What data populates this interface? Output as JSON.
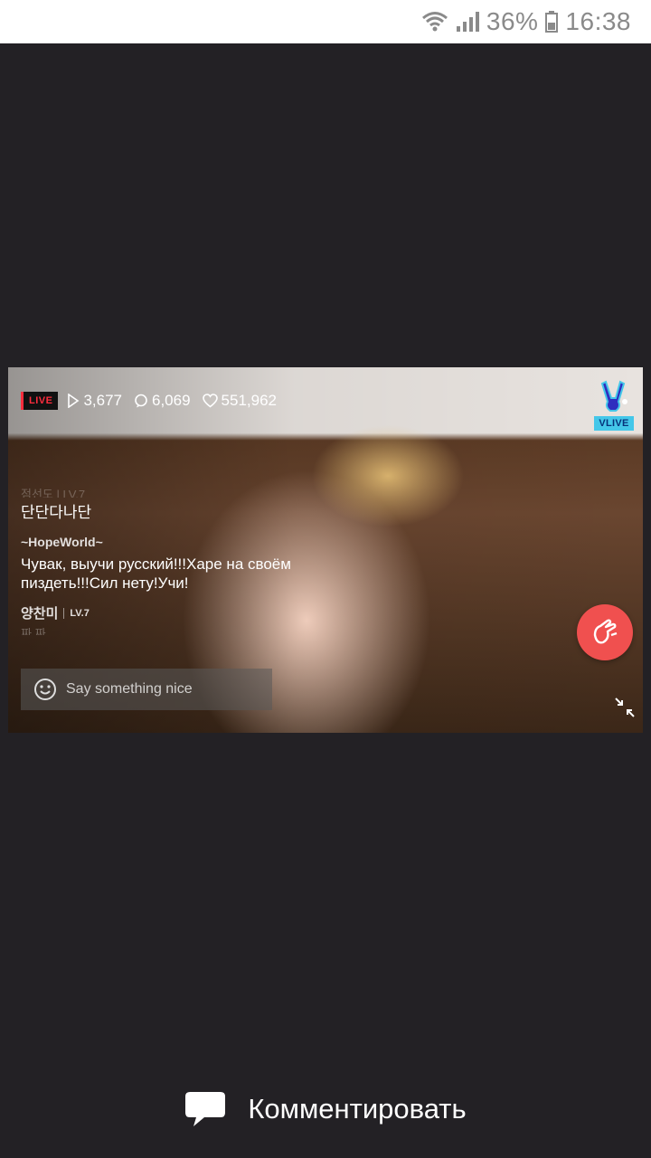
{
  "status_bar": {
    "battery": "36%",
    "time": "16:38",
    "icons": [
      "wifi-icon",
      "signal-icon",
      "battery-icon"
    ]
  },
  "player": {
    "live_label": "LIVE",
    "views": "3,677",
    "comments": "6,069",
    "likes": "551,962",
    "logo_text": "VLIVE",
    "colors": {
      "live": "#ff2d3d",
      "heart_button": "#f0504f",
      "logo": "#44c7e9"
    }
  },
  "chat": {
    "faded_top": "점선도 | LV.7",
    "messages": [
      {
        "user": "",
        "text": "단단다나단"
      },
      {
        "user": "~HopeWorld~",
        "text": "Чувак, выучи русский!!!Харе на своём пиздеть!!!Сил нету!Учи!"
      }
    ],
    "last_user": "양찬미",
    "last_level": "LV.7",
    "faded_bottom": "짜 짜"
  },
  "comment_input": {
    "placeholder": "Say something nice"
  },
  "footer": {
    "label": "Комментировать"
  }
}
